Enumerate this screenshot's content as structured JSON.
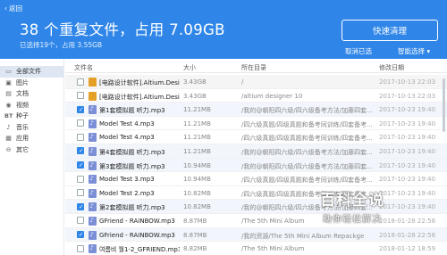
{
  "header": {
    "back_label": "返回",
    "title": "38 个重复文件，占用 7.09GB",
    "subtitle": "已选择19个，占用 3.55GB",
    "clean_button": "快速清理",
    "cancel_select": "取消已选",
    "smart_select": "智能选择 ▾"
  },
  "sidebar": {
    "items": [
      {
        "label": "全部文件",
        "icon": "folder-icon",
        "active": true
      },
      {
        "label": "图片",
        "icon": "image-icon"
      },
      {
        "label": "文档",
        "icon": "document-icon"
      },
      {
        "label": "视频",
        "icon": "video-icon"
      },
      {
        "label": "种子",
        "icon": "bt-icon"
      },
      {
        "label": "音乐",
        "icon": "music-icon"
      },
      {
        "label": "应用",
        "icon": "app-icon"
      },
      {
        "label": "其它",
        "icon": "other-icon"
      }
    ]
  },
  "columns": {
    "name": "文件名",
    "size": "大小",
    "dir": "所在目录",
    "date": "修改日期"
  },
  "rows": [
    {
      "checked": false,
      "type": "zip",
      "name": "[电路设计软件].Altium.Design",
      "size": "3.43GB",
      "dir": "/",
      "date": "2017-10-13 22:03",
      "grp": true
    },
    {
      "checked": false,
      "type": "zip",
      "name": "[电路设计软件].Altium.Design",
      "size": "3.43GB",
      "dir": "/altium designer 10",
      "date": "2017-10-13 22:03"
    },
    {
      "checked": true,
      "type": "mp3",
      "name": "第1套模拟题 听力.mp3",
      "size": "11.21MB",
      "dir": "/我的@朝阳四六级/四六级备考方法/加藤四套...",
      "date": "2017-10-23 19:40"
    },
    {
      "checked": false,
      "type": "mp3",
      "name": "Model Test 4.mp3",
      "size": "11.21MB",
      "dir": "/四六级真题/四级真题和备考同训练/四套备考...",
      "date": "2017-10-23 19:40"
    },
    {
      "checked": false,
      "type": "mp3",
      "name": "Model Test 4.mp3",
      "size": "11.21MB",
      "dir": "/四六级真题/四级真题和备考同训练/四套备考...",
      "date": "2017-10-23 19:40"
    },
    {
      "checked": true,
      "type": "mp3",
      "name": "第4套模拟题 听力.mp3",
      "size": "11.21MB",
      "dir": "/我的@朝阳四六级/四六级备考方法/加藤四套...",
      "date": "2017-10-23 19:40"
    },
    {
      "checked": true,
      "type": "mp3",
      "name": "第3套模拟题 听力.mp3",
      "size": "10.94MB",
      "dir": "/我的@朝阳四六级/四六级备考方法/加藤四套...",
      "date": "2017-10-23 19:40"
    },
    {
      "checked": false,
      "type": "mp3",
      "name": "Model Test 3.mp3",
      "size": "10.94MB",
      "dir": "/四六级真题/四级真题和备考同训练/四套备考...",
      "date": "2017-10-23 19:40"
    },
    {
      "checked": false,
      "type": "mp3",
      "name": "Model Test 2.mp3",
      "size": "10.82MB",
      "dir": "/四六级真题/四级真题和备考同训练/四套备考...",
      "date": "2017-10-23 19:40"
    },
    {
      "checked": true,
      "type": "mp3",
      "name": "第2套模拟题 听力.mp3",
      "size": "10.82MB",
      "dir": "/我的@朝阳四六级/四六级备考方法/加藤四套...",
      "date": "2017-10-23 19:40"
    },
    {
      "checked": false,
      "type": "mp3",
      "name": "GFriend - RAINBOW.mp3",
      "size": "8.87MB",
      "dir": "/The 5th Mini Album",
      "date": "2018-01-28 22:58"
    },
    {
      "checked": true,
      "type": "mp3",
      "name": "GFriend - RAINBOW.mp3",
      "size": "8.87MB",
      "dir": "/我的资源/The 5th Mini Album Repackge",
      "date": "2018-01-28 22:58"
    },
    {
      "checked": false,
      "type": "mp3",
      "name": "여름비 월1-2_GFRIEND.mp3",
      "size": "8.82MB",
      "dir": "/The 5th Mini Album",
      "date": "2018-01-12 18:59"
    }
  ],
  "watermark": {
    "line1": "百科全说",
    "line2": "助你轻松解决"
  },
  "colors": {
    "header_bg": "#2f86e8",
    "accent": "#2f86e8",
    "selected_row": "#f2f6fc"
  }
}
